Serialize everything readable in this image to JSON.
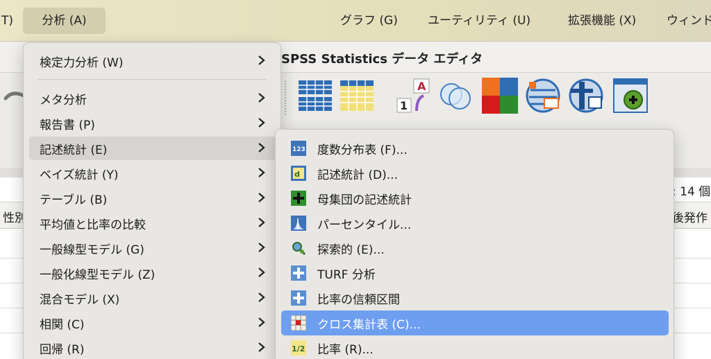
{
  "menubar": {
    "partial_left": "T)",
    "analyze": "分析 (A)",
    "graphs": "グラフ (G)",
    "utilities": "ユーティリティ (U)",
    "extensions": "拡張機能 (X)",
    "window_partial": "ウィンド"
  },
  "window": {
    "title": "SPSS Statistics データ エディタ",
    "var_count_partial": ": 14 個",
    "col_left_partial": "性別",
    "col_right_partial": "後発作"
  },
  "analyze_menu": {
    "items": [
      {
        "label": "検定力分析 (W)",
        "has_submenu": true
      },
      {
        "label": "メタ分析",
        "has_submenu": true
      },
      {
        "label": "報告書 (P)",
        "has_submenu": true
      },
      {
        "label": "記述統計 (E)",
        "has_submenu": true,
        "highlighted": true
      },
      {
        "label": "ベイズ統計 (Y)",
        "has_submenu": true
      },
      {
        "label": "テーブル (B)",
        "has_submenu": true
      },
      {
        "label": "平均値と比率の比較",
        "has_submenu": true
      },
      {
        "label": "一般線型モデル (G)",
        "has_submenu": true
      },
      {
        "label": "一般化線型モデル (Z)",
        "has_submenu": true
      },
      {
        "label": "混合モデル (X)",
        "has_submenu": true
      },
      {
        "label": "相関 (C)",
        "has_submenu": true
      },
      {
        "label": "回帰 (R)",
        "has_submenu": true
      }
    ]
  },
  "descriptive_submenu": {
    "items": [
      {
        "label": "度数分布表 (F)...",
        "icon": "frequencies-icon"
      },
      {
        "label": "記述統計 (D)...",
        "icon": "descriptives-icon"
      },
      {
        "label": "母集団の記述統計",
        "icon": "plus-icon"
      },
      {
        "label": "パーセンタイル...",
        "icon": "percentile-icon"
      },
      {
        "label": "探索的 (E)...",
        "icon": "explore-icon"
      },
      {
        "label": "TURF 分析",
        "icon": "plus-icon"
      },
      {
        "label": "比率の信頼区間",
        "icon": "plus-icon"
      },
      {
        "label": "クロス集計表 (C)...",
        "icon": "crosstabs-icon",
        "selected": true
      },
      {
        "label": "比率 (R)...",
        "icon": "ratio-icon"
      }
    ]
  },
  "colors": {
    "selection": "#6e9ef0",
    "menubar": "#e6e1c0",
    "menu_bg": "#e9e7e4"
  }
}
